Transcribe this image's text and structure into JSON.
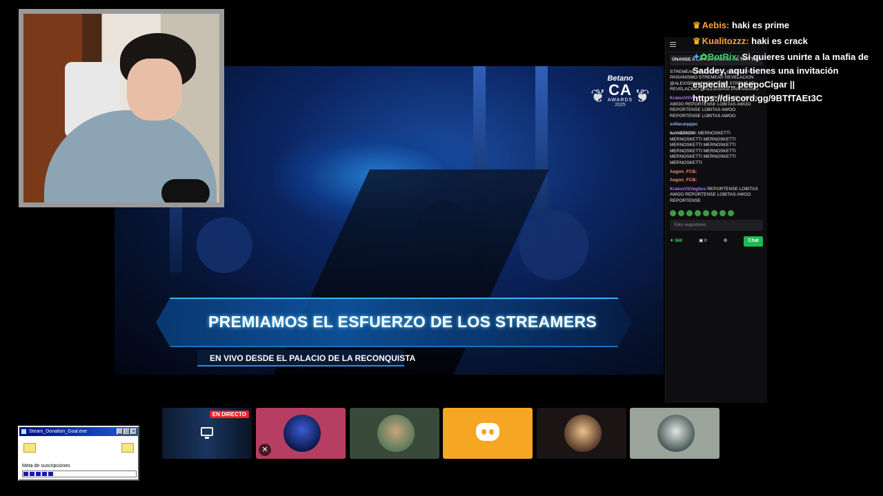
{
  "stream": {
    "brand_name": "Betano",
    "award_logo": "CA",
    "award_sub": "AWARDS",
    "award_year": "2025",
    "banner_title": "PREMIAMOS EL ESFUERZO DE LOS STREAMERS",
    "banner_subtitle": "EN VIVO DESDE EL PALACIO DE LA RECONQUISTA"
  },
  "chat_overlay": [
    {
      "user": "Aebis:",
      "text": "haki es prime",
      "badge": "crown-icon"
    },
    {
      "user": "Kualitozzz:",
      "text": "haki es crack",
      "badge": "crown-icon"
    },
    {
      "user": "BotRix:",
      "text": "Si quieres unirte a la mafia de Saddey, aquí tienes una invitación especial... peepoCigar || https://discord.gg/9BTfTAEt3C",
      "badge": "bot-icon"
    }
  ],
  "chat_panel": {
    "pinned": "ÚNANSE A LA COMUNIDAD DE TWITTER",
    "messages": [
      {
        "user": "",
        "text": "STREMEAR REVELACION @ALEXISPAIII PAISANISMO STREMEAR REVELACION @ALEXISPAIII PAISANISMO STREMEAR REVELACION @ALEXISPAIII PAISANISMO"
      },
      {
        "user": "KratosVSVegitos",
        "text": "REPORTENSE LOBITAS AWOO REPORTENSE LOBITAS AWOO REPORTENSE LOBITAS AWOO REPORTENSE LOBITAS AWOO"
      },
      {
        "user": "sofiacarpppc",
        "text": ""
      },
      {
        "user": "luchi826200:",
        "text": "MERNOSKETTI MERNOSKETTI MERNOSKETTI MERNOSKETTI MERNOSKETTI MERNOSKETTI MERNOSKETTI MERNOSKETTI MERNOSKETTI MERNOSKETTI"
      },
      {
        "user": "Aegon_FCB:",
        "text": ""
      },
      {
        "user": "Aegon_FCB:",
        "text": ""
      },
      {
        "user": "KratosVSVegitos",
        "text": "REPORTENSE LOBITAS AWOO REPORTENSE LOBITAS AWOO REPORTENSE"
      }
    ],
    "input_placeholder": "Solo seguidores",
    "points": "560",
    "bits": "0",
    "chat_button": "Chat"
  },
  "tiles": {
    "live_label": "EN DIRECTO"
  },
  "donation": {
    "window_title": "Steam_Donation_Goal.exe",
    "label": "Meta de suscripciones",
    "progress": 0.28
  },
  "colors": {
    "accent_green": "#1db954",
    "tile_pink": "#b73e63",
    "tile_olive": "#3a4a3a",
    "tile_discord": "#f5a623",
    "tile_dark": "#1a1414",
    "tile_grey": "#9aa49a"
  }
}
